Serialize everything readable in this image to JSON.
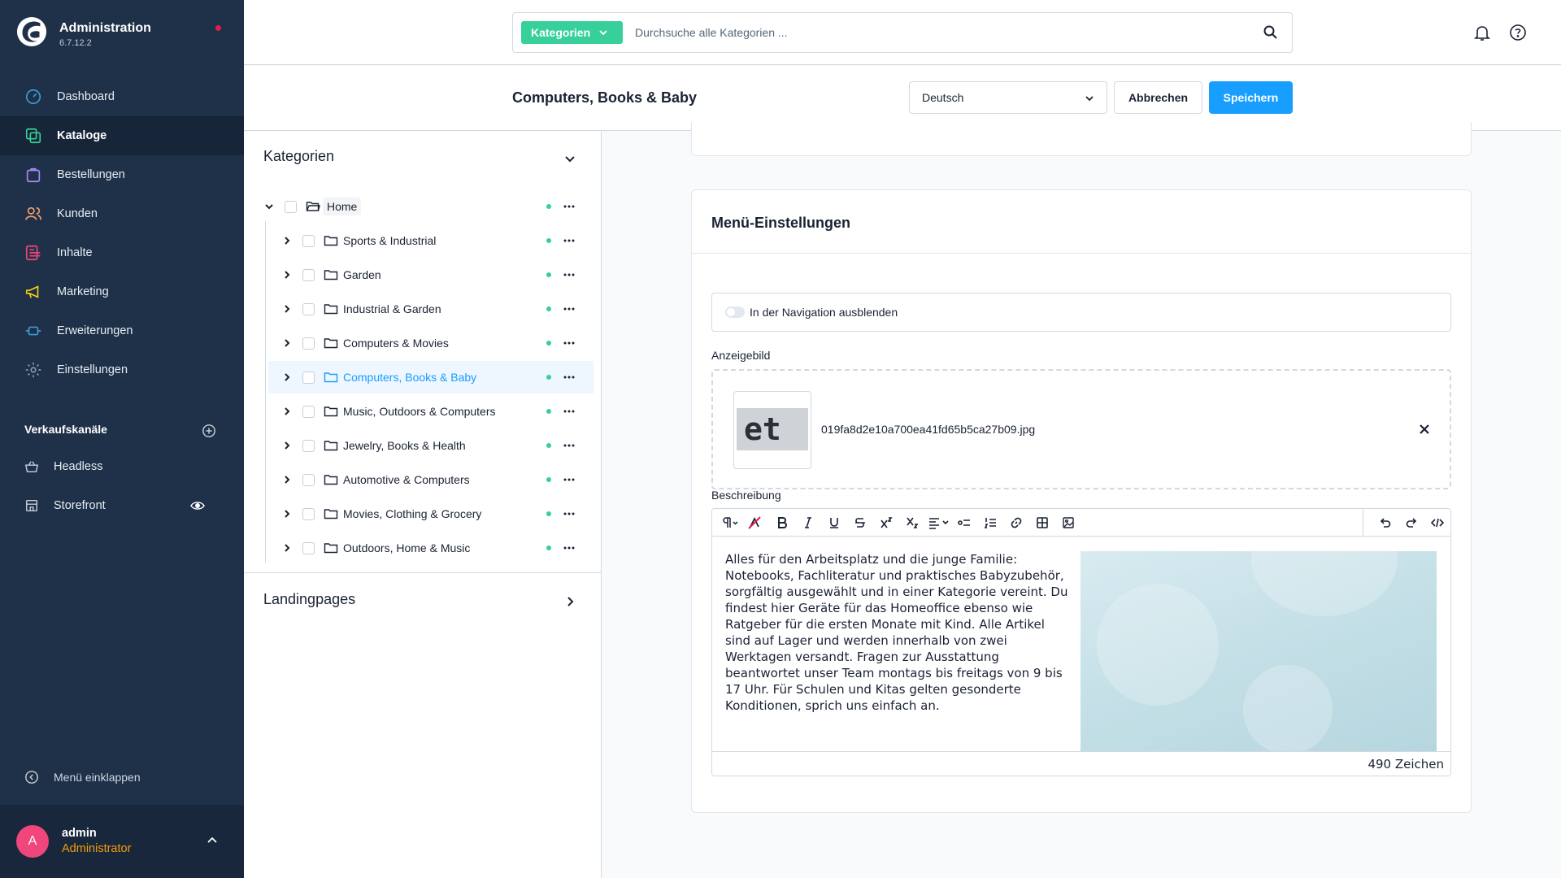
{
  "app": {
    "title": "Administration",
    "version": "6.7.12.2"
  },
  "sidebar": {
    "items": [
      {
        "label": "Dashboard",
        "icon": "gauge-icon",
        "color": "#3b9bd8"
      },
      {
        "label": "Kataloge",
        "icon": "catalog-icon",
        "color": "#37d09b"
      },
      {
        "label": "Bestellungen",
        "icon": "shopping-bag-icon",
        "color": "#a78bfa"
      },
      {
        "label": "Kunden",
        "icon": "users-icon",
        "color": "#f59e6b"
      },
      {
        "label": "Inhalte",
        "icon": "content-icon",
        "color": "#f0467b"
      },
      {
        "label": "Marketing",
        "icon": "megaphone-icon",
        "color": "#facc15"
      },
      {
        "label": "Erweiterungen",
        "icon": "plug-icon",
        "color": "#3b9bd8"
      },
      {
        "label": "Einstellungen",
        "icon": "gear-icon",
        "color": "#8a9bb0"
      }
    ],
    "active": "Kataloge",
    "sales_channels": {
      "title": "Verkaufskanäle",
      "items": [
        {
          "label": "Headless",
          "icon": "basket-icon"
        },
        {
          "label": "Storefront",
          "icon": "storefront-icon"
        }
      ]
    },
    "collapse_label": "Menü einklappen",
    "user": {
      "initial": "A",
      "name": "admin",
      "role": "Administrator"
    }
  },
  "search": {
    "type_label": "Kategorien",
    "placeholder": "Durchsuche alle Kategorien ..."
  },
  "smartbar": {
    "title": "Computers, Books & Baby",
    "language": "Deutsch",
    "cancel_label": "Abbrechen",
    "save_label": "Speichern"
  },
  "tree": {
    "header": "Kategorien",
    "root": "Home",
    "children": [
      "Sports & Industrial",
      "Garden",
      "Industrial & Garden",
      "Computers & Movies",
      "Computers, Books & Baby",
      "Music, Outdoors & Computers",
      "Jewelry, Books & Health",
      "Automotive & Computers",
      "Movies, Clothing & Grocery",
      "Outdoors, Home & Music"
    ],
    "selected": "Computers, Books & Baby",
    "landing_header": "Landingpages"
  },
  "menu_settings": {
    "title": "Menü-Einstellungen",
    "hide_in_nav_label": "In der Navigation ausblenden",
    "image_label": "Anzeigebild",
    "image_thumb_text": "et",
    "file_name": "019fa8d2e10a700ea41fd65b5ca27b09.jpg",
    "description_label": "Beschreibung",
    "description_text": "Alles für den Arbeitsplatz und die junge Familie: Notebooks, Fachliteratur und praktisches Babyzubehör, sorgfältig ausgewählt und in einer Kategorie vereint. Du findest hier Geräte für das Homeoffice ebenso wie Ratgeber für die ersten Monate mit Kind. Alle Artikel sind auf Lager und werden innerhalb von zwei Werktagen versandt. Fragen zur Ausstattung beantwortet unser Team montags bis freitags von 9 bis 17 Uhr. Für Schulen und Kitas gelten gesonderte Konditionen, sprich uns einfach an.",
    "char_count": "490 Zeichen"
  }
}
